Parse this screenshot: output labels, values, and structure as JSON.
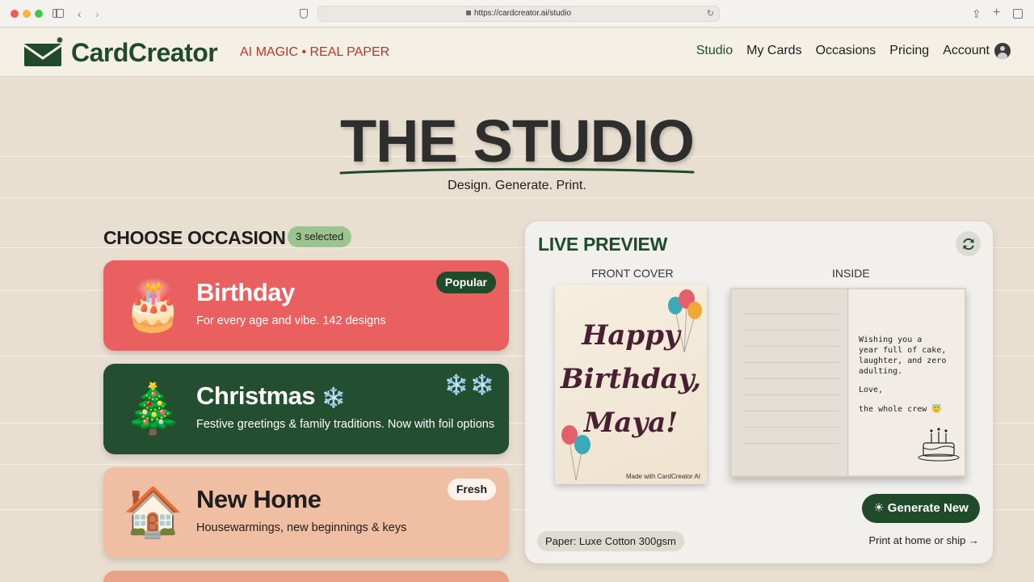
{
  "browser": {
    "url": "https://cardcreator.ai/studio"
  },
  "header": {
    "brand": "CardCreator",
    "tagline": "AI MAGIC • REAL PAPER",
    "nav": [
      "Studio",
      "My Cards",
      "Occasions",
      "Pricing",
      "Account"
    ],
    "active_nav": "Studio"
  },
  "hero": {
    "title": "THE STUDIO",
    "subtitle": "Design. Generate. Print."
  },
  "occasions": {
    "title": "CHOOSE OCCASION",
    "selected_count": "3 selected",
    "items": [
      {
        "emoji": "🎂",
        "title": "Birthday",
        "description": "For every age and vibe. 142 designs",
        "badge": "Popular",
        "color": "#ea5f60"
      },
      {
        "emoji": "🎄",
        "title": "Christmas",
        "title_icon": "❄️",
        "description": "Festive greetings & family traditions. Now with foil options",
        "badge": "❄️❄️",
        "color": "#234e2f"
      },
      {
        "emoji": "🏠",
        "title": "New Home",
        "description": "Housewarmings, new beginnings & keys",
        "badge": "Fresh",
        "color": "#f0bea2"
      }
    ]
  },
  "preview": {
    "title": "LIVE PREVIEW",
    "front_label": "FRONT COVER",
    "inside_label": "INSIDE",
    "front_text": [
      "Happy",
      "Birthday,",
      "Maya!"
    ],
    "front_footer": "Made with CardCreator AI",
    "inside_message": "Wishing you a\nyear full of cake,\nlaughter, and zero\nadulting.",
    "inside_signoff": "Love,",
    "inside_signature": "the whole crew 😇",
    "generate_label": "Generate New",
    "paper": "Paper: Luxe Cotton 300gsm",
    "print_link": "Print at home or ship →"
  },
  "colors": {
    "brand_green": "#1f4b2a",
    "accent_red": "#b8372a",
    "page_bg": "#e9dfd1"
  }
}
